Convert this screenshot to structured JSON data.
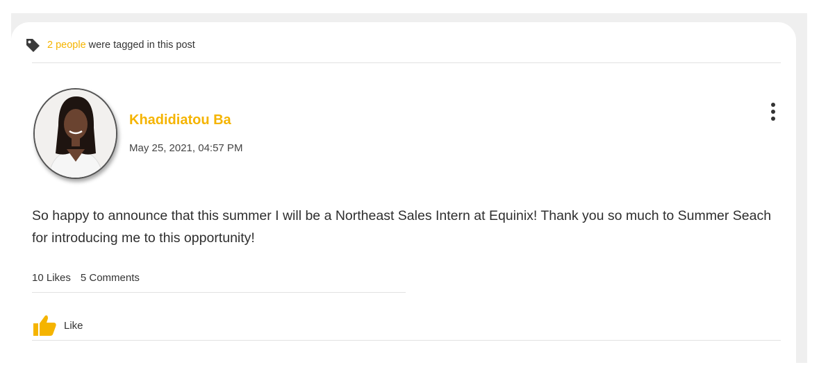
{
  "tags": {
    "count_text": "2 people",
    "suffix_text": "were tagged in this post",
    "icon": "tag-icon"
  },
  "post": {
    "author_name": "Khadidiatou Ba",
    "date": "May 25, 2021, 04:57 PM",
    "body": "So happy to announce that this summer I will be a Northeast Sales Intern at Equinix! Thank you so much to Summer Seach for introducing me to this opportunity!",
    "menu_icon": "more-vertical-icon"
  },
  "stats": {
    "likes": "10 Likes",
    "comments": "5 Comments"
  },
  "actions": {
    "like_label": "Like",
    "like_icon": "thumbs-up-icon"
  },
  "colors": {
    "accent": "#f5b400",
    "text": "#2e2e2e",
    "divider": "#e2e2e2",
    "page_bg": "#efefef"
  }
}
